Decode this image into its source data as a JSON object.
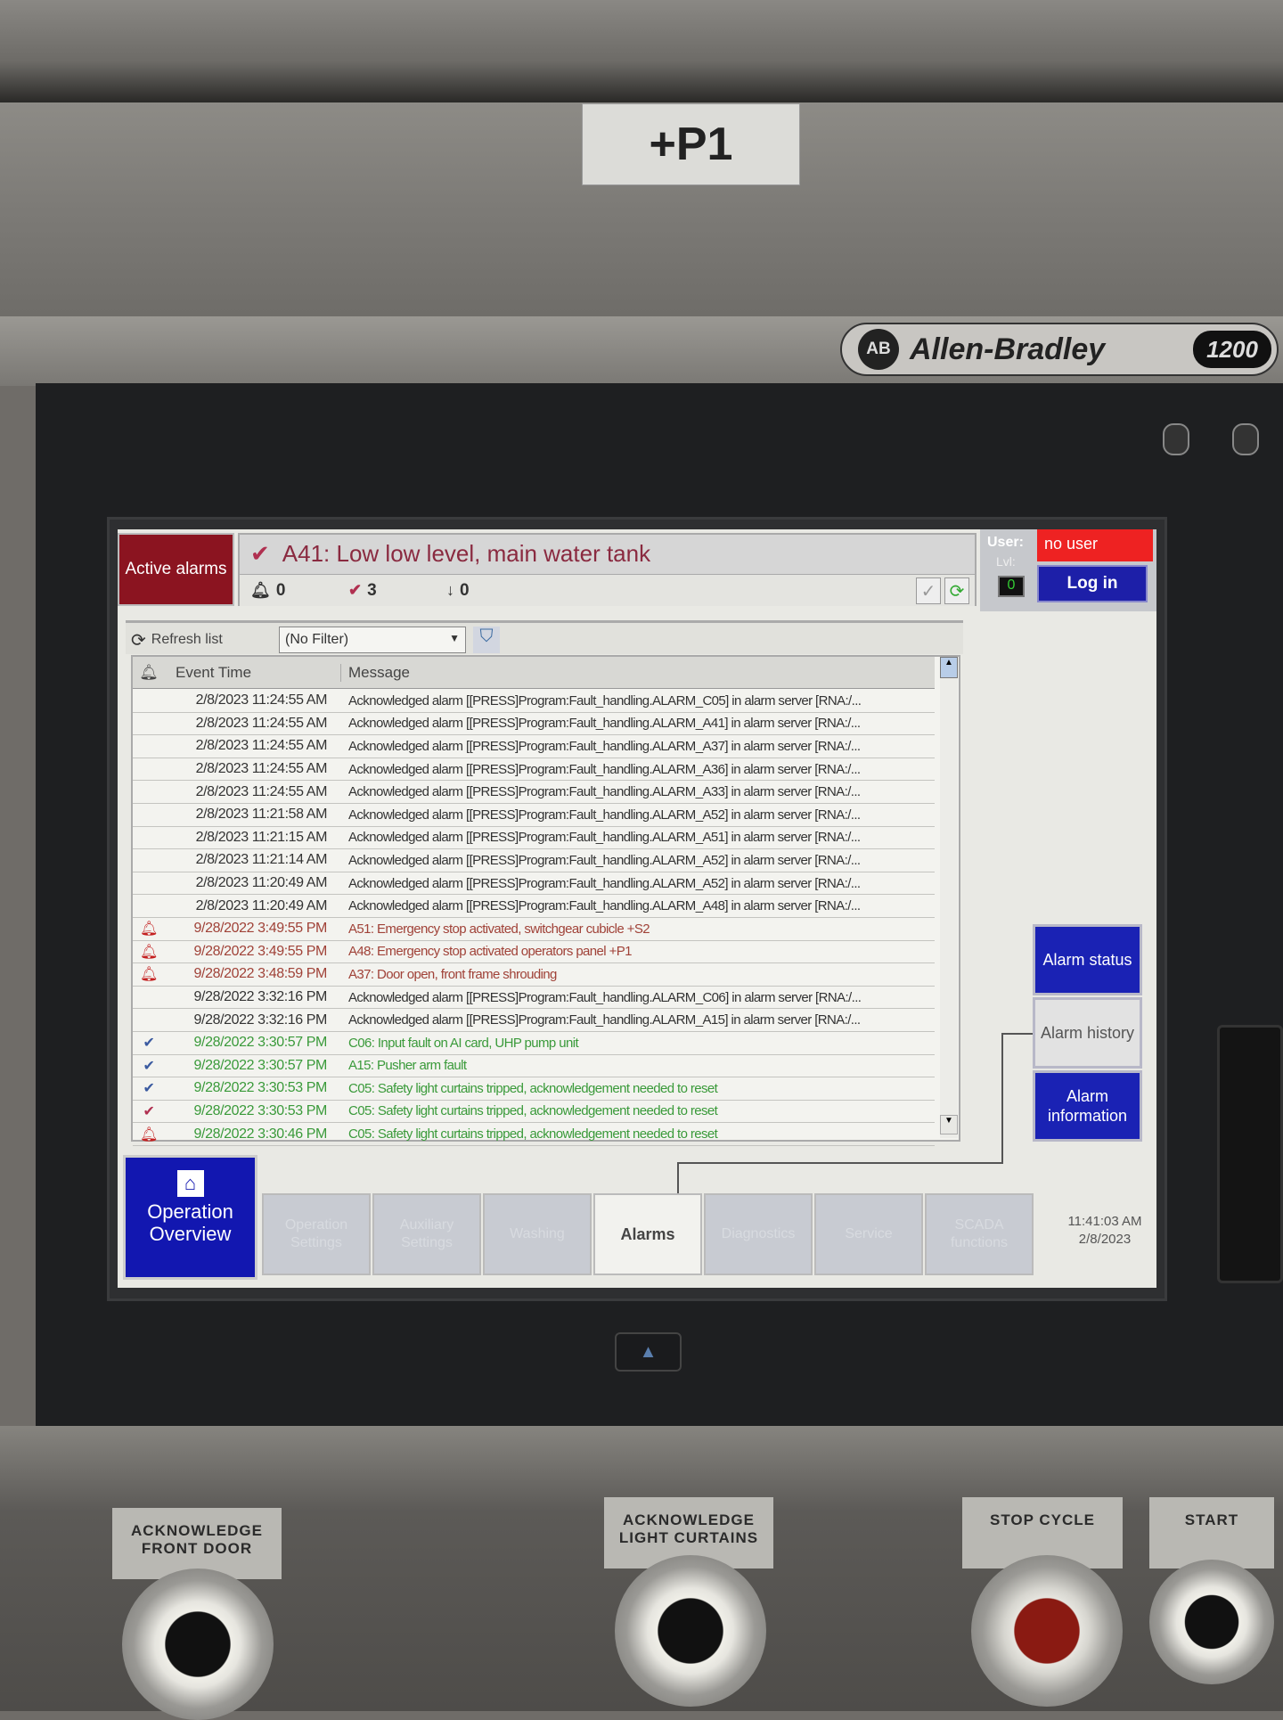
{
  "panel": {
    "label": "+P1",
    "brand": "Allen-Bradley",
    "brand_logo": "AB",
    "model": "1200"
  },
  "header": {
    "active_alarms_label": "Active alarms",
    "current_alarm": "A41: Low low level, main water tank",
    "counts": {
      "in_alarm": "0",
      "unacked": "3",
      "normal_unacked": "0"
    },
    "user_label": "User:",
    "user": "no user",
    "level_label": "Lvl:",
    "level": "0",
    "login_label": "Log in"
  },
  "toolbar": {
    "refresh_label": "Refresh list",
    "filter_value": "(No Filter)"
  },
  "table": {
    "columns": [
      "Event Time",
      "Message"
    ],
    "rows": [
      {
        "time": "2/8/2023 11:24:55 AM",
        "message": "Acknowledged alarm [[PRESS]Program:Fault_handling.ALARM_C05] in alarm server [RNA:/...",
        "state": "ack",
        "icon": ""
      },
      {
        "time": "2/8/2023 11:24:55 AM",
        "message": "Acknowledged alarm [[PRESS]Program:Fault_handling.ALARM_A41] in alarm server [RNA:/...",
        "state": "ack",
        "icon": ""
      },
      {
        "time": "2/8/2023 11:24:55 AM",
        "message": "Acknowledged alarm [[PRESS]Program:Fault_handling.ALARM_A37] in alarm server [RNA:/...",
        "state": "ack",
        "icon": ""
      },
      {
        "time": "2/8/2023 11:24:55 AM",
        "message": "Acknowledged alarm [[PRESS]Program:Fault_handling.ALARM_A36] in alarm server [RNA:/...",
        "state": "ack",
        "icon": ""
      },
      {
        "time": "2/8/2023 11:24:55 AM",
        "message": "Acknowledged alarm [[PRESS]Program:Fault_handling.ALARM_A33] in alarm server [RNA:/...",
        "state": "ack",
        "icon": ""
      },
      {
        "time": "2/8/2023 11:21:58 AM",
        "message": "Acknowledged alarm [[PRESS]Program:Fault_handling.ALARM_A52] in alarm server [RNA:/...",
        "state": "ack",
        "icon": ""
      },
      {
        "time": "2/8/2023 11:21:15 AM",
        "message": "Acknowledged alarm [[PRESS]Program:Fault_handling.ALARM_A51] in alarm server [RNA:/...",
        "state": "ack",
        "icon": ""
      },
      {
        "time": "2/8/2023 11:21:14 AM",
        "message": "Acknowledged alarm [[PRESS]Program:Fault_handling.ALARM_A52] in alarm server [RNA:/...",
        "state": "ack",
        "icon": ""
      },
      {
        "time": "2/8/2023 11:20:49 AM",
        "message": "Acknowledged alarm [[PRESS]Program:Fault_handling.ALARM_A52] in alarm server [RNA:/...",
        "state": "ack",
        "icon": ""
      },
      {
        "time": "2/8/2023 11:20:49 AM",
        "message": "Acknowledged alarm [[PRESS]Program:Fault_handling.ALARM_A48] in alarm server [RNA:/...",
        "state": "ack",
        "icon": ""
      },
      {
        "time": "9/28/2022 3:49:55 PM",
        "message": "A51: Emergency stop activated, switchgear cubicle +S2",
        "state": "active",
        "icon": "bell"
      },
      {
        "time": "9/28/2022 3:49:55 PM",
        "message": "A48: Emergency stop activated operators panel +P1",
        "state": "active",
        "icon": "bell"
      },
      {
        "time": "9/28/2022 3:48:59 PM",
        "message": "A37: Door open, front frame shrouding",
        "state": "active",
        "icon": "bell"
      },
      {
        "time": "9/28/2022 3:32:16 PM",
        "message": "Acknowledged alarm [[PRESS]Program:Fault_handling.ALARM_C06] in alarm server [RNA:/...",
        "state": "ack",
        "icon": ""
      },
      {
        "time": "9/28/2022 3:32:16 PM",
        "message": "Acknowledged alarm [[PRESS]Program:Fault_handling.ALARM_A15] in alarm server [RNA:/...",
        "state": "ack",
        "icon": ""
      },
      {
        "time": "9/28/2022 3:30:57 PM",
        "message": "C06: Input fault on AI card, UHP pump unit",
        "state": "green",
        "icon": "acked"
      },
      {
        "time": "9/28/2022 3:30:57 PM",
        "message": "A15: Pusher arm fault",
        "state": "green",
        "icon": "acked"
      },
      {
        "time": "9/28/2022 3:30:53 PM",
        "message": "C05: Safety light curtains tripped, acknowledgement needed to reset",
        "state": "green",
        "icon": "acked"
      },
      {
        "time": "9/28/2022 3:30:53 PM",
        "message": "C05: Safety light curtains tripped, acknowledgement needed to reset",
        "state": "green",
        "icon": "unacked"
      },
      {
        "time": "9/28/2022 3:30:46 PM",
        "message": "C05: Safety light curtains tripped, acknowledgement needed to reset",
        "state": "green",
        "icon": "bell"
      }
    ]
  },
  "side_buttons": [
    "Alarm status",
    "Alarm history",
    "Alarm information"
  ],
  "nav": {
    "home_label": "Operation Overview",
    "tabs": [
      "Operation Settings",
      "Auxiliary Settings",
      "Washing",
      "Alarms",
      "Diagnostics",
      "Service",
      "SCADA functions"
    ],
    "active_tab": "Alarms"
  },
  "clock": {
    "time": "11:41:03 AM",
    "date": "2/8/2023"
  },
  "pushbuttons": [
    "ACKNOWLEDGE FRONT DOOR",
    "ACKNOWLEDGE LIGHT CURTAINS",
    "STOP CYCLE",
    "START"
  ],
  "colors": {
    "active_alarms": "#8b1420",
    "blue_button": "#1a22b4",
    "no_user": "#e22222",
    "active_text": "#a04238",
    "green_text": "#3a9a3a"
  }
}
